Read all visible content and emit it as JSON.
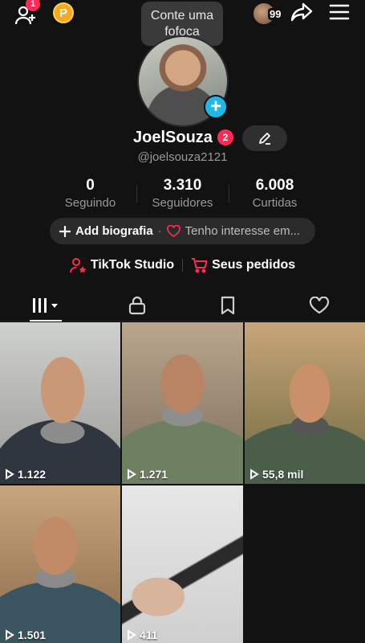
{
  "topbar": {
    "notifications_count": "1",
    "coin_label": "P",
    "gossip_prompt": "Conte uma fofoca",
    "friends_count": "99"
  },
  "profile": {
    "username": "JoelSouza",
    "username_badge": "2",
    "handle": "@joelsouza2121"
  },
  "stats": [
    {
      "value": "0",
      "label": "Seguindo"
    },
    {
      "value": "3.310",
      "label": "Seguidores"
    },
    {
      "value": "6.008",
      "label": "Curtidas"
    }
  ],
  "bio": {
    "add_label": "Add biografia",
    "separator": "·",
    "interest_label": "Tenho interesse em..."
  },
  "links": {
    "studio_label": "TikTok Studio",
    "orders_label": "Seus pedidos"
  },
  "tabs": [
    "videos-grid-icon",
    "lock-icon",
    "bookmark-icon",
    "heart-icon"
  ],
  "videos": [
    {
      "views": "1.122"
    },
    {
      "views": "1.271"
    },
    {
      "views": "55,8 mil"
    },
    {
      "views": "1.501"
    },
    {
      "views": "411"
    }
  ],
  "colors": {
    "background": "#121212",
    "accent_red": "#fe2c55",
    "accent_blue": "#20b8e9",
    "coin": "#f6a821"
  }
}
